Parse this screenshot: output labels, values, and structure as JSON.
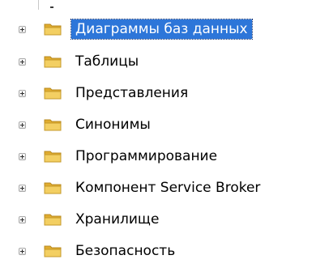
{
  "tree": {
    "nodes": [
      {
        "label": "Диаграммы баз данных",
        "selected": true,
        "icon": "folder-icon"
      },
      {
        "label": "Таблицы",
        "selected": false,
        "icon": "folder-icon"
      },
      {
        "label": "Представления",
        "selected": false,
        "icon": "folder-icon"
      },
      {
        "label": "Синонимы",
        "selected": false,
        "icon": "folder-icon"
      },
      {
        "label": "Программирование",
        "selected": false,
        "icon": "folder-icon"
      },
      {
        "label": "Компонент Service Broker",
        "selected": false,
        "icon": "folder-icon"
      },
      {
        "label": "Хранилище",
        "selected": false,
        "icon": "folder-icon"
      },
      {
        "label": "Безопасность",
        "selected": false,
        "icon": "folder-icon"
      }
    ]
  },
  "colors": {
    "selection_background": "#2d76d9",
    "selection_text": "#ffffff",
    "folder_front": "#f3cf62",
    "folder_back": "#e0ac2f"
  }
}
